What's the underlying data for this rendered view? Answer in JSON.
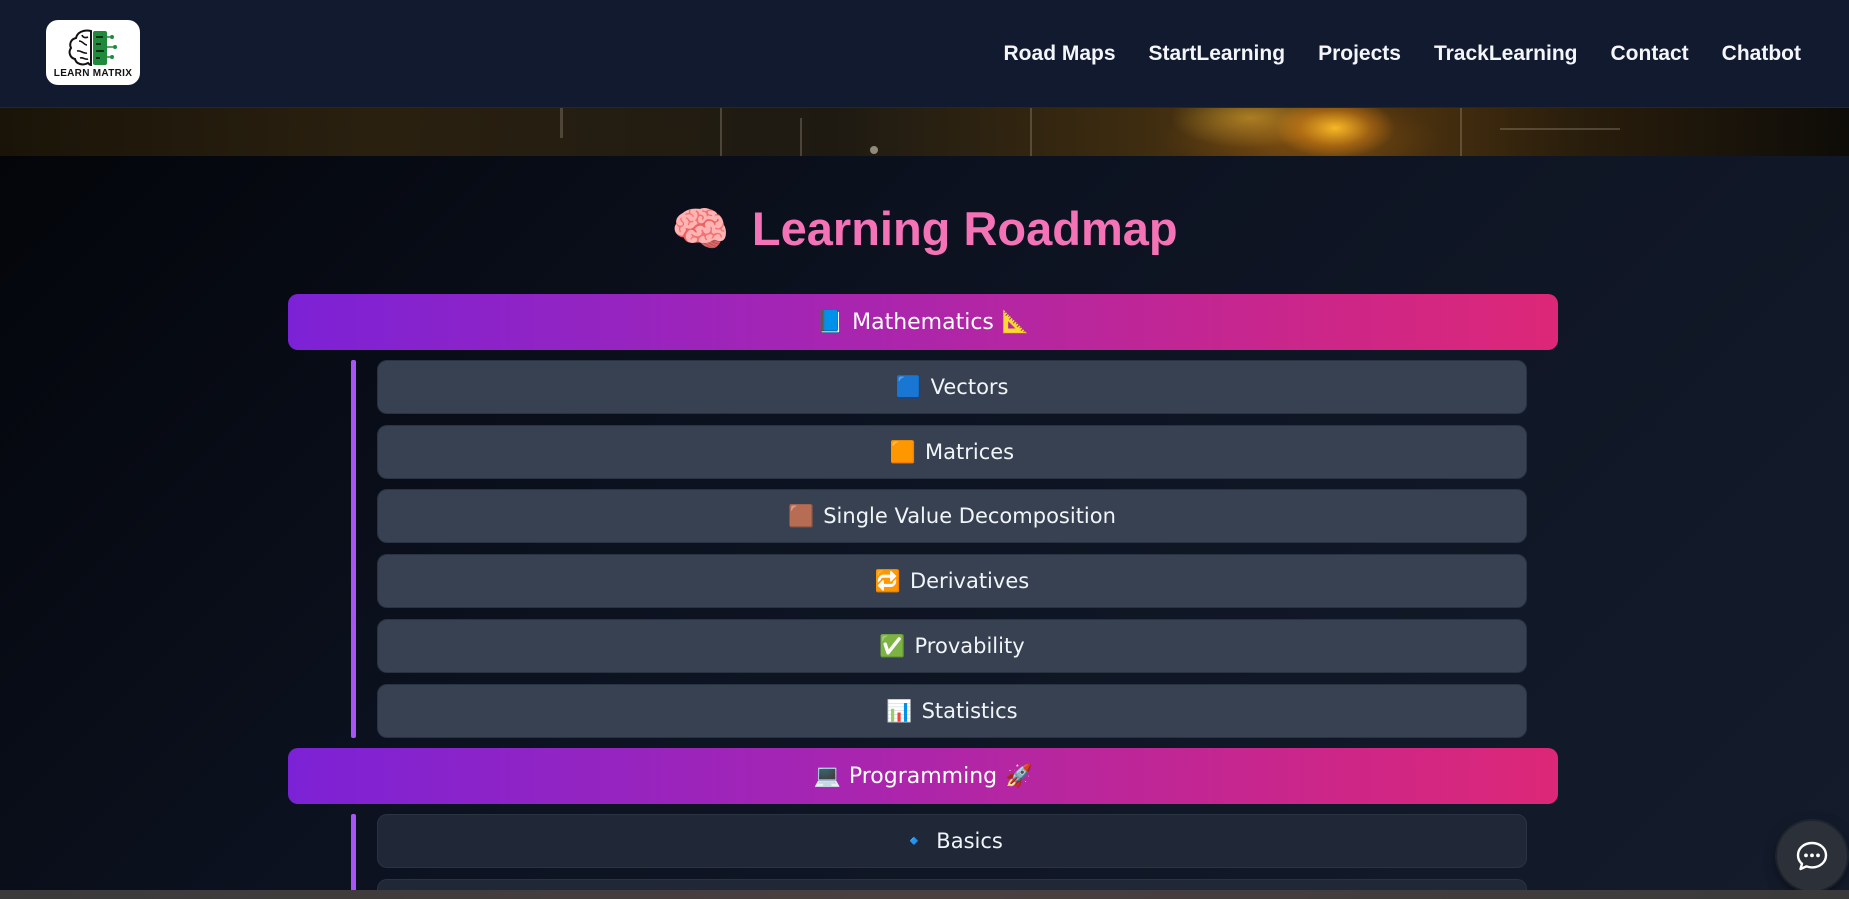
{
  "header": {
    "logo_text": "LEARN MATRIX",
    "nav": [
      "Road Maps",
      "StartLearning",
      "Projects",
      "TrackLearning",
      "Contact",
      "Chatbot"
    ]
  },
  "page": {
    "title_icon": "🧠",
    "title": "Learning Roadmap"
  },
  "roadmap": [
    {
      "label": "Mathematics",
      "icon_left": "📘",
      "icon_right": "📐",
      "topics": [
        {
          "icon": "🟦",
          "label": "Vectors"
        },
        {
          "icon": "🟧",
          "label": "Matrices"
        },
        {
          "icon": "🟫",
          "label": "Single Value Decomposition"
        },
        {
          "icon": "🔁",
          "label": "Derivatives"
        },
        {
          "icon": "✅",
          "label": "Provability"
        },
        {
          "icon": "📊",
          "label": "Statistics"
        }
      ]
    },
    {
      "label": "Programming",
      "icon_left": "💻",
      "icon_right": "🚀",
      "topics": [
        {
          "icon": "🔹",
          "label": "Basics"
        }
      ]
    }
  ],
  "chat_button": {
    "icon": "chat-bubble-icon"
  },
  "colors": {
    "accent_pink": "#f472b6",
    "gradient_start": "#7c22d6",
    "gradient_end": "#dd2778",
    "timeline": "#a855f7",
    "topic_bg": "#374151",
    "nav_bg": "#111a2e"
  }
}
